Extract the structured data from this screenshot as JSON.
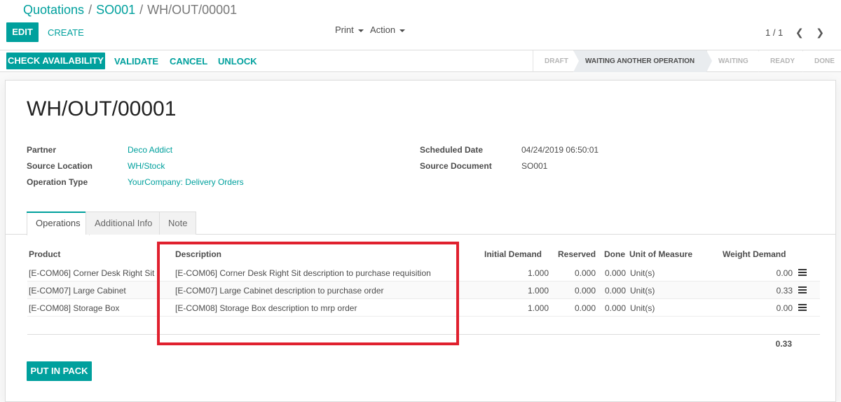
{
  "breadcrumb": {
    "root": "Quotations",
    "parent": "SO001",
    "current": "WH/OUT/00001",
    "sep": "/"
  },
  "toolbar": {
    "edit": "EDIT",
    "create": "CREATE",
    "print": "Print",
    "action": "Action",
    "pager": "1 / 1"
  },
  "header_buttons": {
    "check_availability": "CHECK AVAILABILITY",
    "validate": "VALIDATE",
    "cancel": "CANCEL",
    "unlock": "UNLOCK"
  },
  "status": {
    "steps": [
      "DRAFT",
      "WAITING ANOTHER OPERATION",
      "WAITING",
      "READY",
      "DONE"
    ],
    "active": "WAITING ANOTHER OPERATION"
  },
  "record": {
    "name": "WH/OUT/00001",
    "fields_left": [
      {
        "label": "Partner",
        "value": "Deco Addict"
      },
      {
        "label": "Source Location",
        "value": "WH/Stock"
      },
      {
        "label": "Operation Type",
        "value": "YourCompany: Delivery Orders"
      }
    ],
    "fields_right": [
      {
        "label": "Scheduled Date",
        "value": "04/24/2019 06:50:01"
      },
      {
        "label": "Source Document",
        "value": "SO001"
      }
    ]
  },
  "tabs": [
    "Operations",
    "Additional Info",
    "Note"
  ],
  "table": {
    "headers": {
      "product": "Product",
      "description": "Description",
      "initial_demand": "Initial Demand",
      "reserved": "Reserved",
      "done": "Done",
      "uom": "Unit of Measure",
      "weight_demand": "Weight Demand"
    },
    "rows": [
      {
        "product": "[E-COM06] Corner Desk Right Sit",
        "description": "[E-COM06] Corner Desk Right Sit description to purchase requisition",
        "initial_demand": "1.000",
        "reserved": "0.000",
        "done": "0.000",
        "uom": "Unit(s)",
        "weight_demand": "0.00"
      },
      {
        "product": "[E-COM07] Large Cabinet",
        "description": "[E-COM07] Large Cabinet description to purchase order",
        "initial_demand": "1.000",
        "reserved": "0.000",
        "done": "0.000",
        "uom": "Unit(s)",
        "weight_demand": "0.33"
      },
      {
        "product": "[E-COM08] Storage Box",
        "description": "[E-COM08] Storage Box description to mrp order",
        "initial_demand": "1.000",
        "reserved": "0.000",
        "done": "0.000",
        "uom": "Unit(s)",
        "weight_demand": "0.00"
      }
    ],
    "total_weight": "0.33"
  },
  "footer": {
    "put_in_pack": "PUT IN PACK"
  },
  "colors": {
    "accent": "#00a09d",
    "highlight": "#e0202e"
  },
  "icons": {
    "prev": "chevron-left-icon",
    "next": "chevron-right-icon",
    "row_detail": "list-icon"
  }
}
